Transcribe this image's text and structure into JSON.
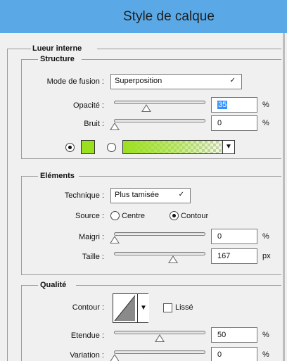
{
  "dialog": {
    "title": "Style de calque"
  },
  "lueur": {
    "heading": "Lueur interne",
    "structure": {
      "heading": "Structure",
      "mode_label": "Mode de fusion :",
      "mode_value": "Superposition",
      "opacity_label": "Opacité :",
      "opacity_value": "35",
      "opacity_unit": "%",
      "opacity_level": 0.35,
      "noise_label": "Bruit :",
      "noise_value": "0",
      "noise_unit": "%",
      "noise_level": 0,
      "color_swatch": "#9be01e",
      "color_mode": "color"
    },
    "elements": {
      "heading": "Eléments",
      "technique_label": "Technique :",
      "technique_value": "Plus tamisée",
      "source_label": "Source :",
      "source_center": "Centre",
      "source_edge": "Contour",
      "source_selected": "edge",
      "choke_label": "Maigri :",
      "choke_value": "0",
      "choke_unit": "%",
      "choke_level": 0,
      "size_label": "Taille :",
      "size_value": "167",
      "size_unit": "px"
    },
    "quality": {
      "heading": "Qualité",
      "contour_label": "Contour :",
      "antialias_label": "Lissé",
      "antialias_checked": false,
      "range_label": "Etendue :",
      "range_value": "50",
      "range_unit": "%",
      "range_level": 0.5,
      "jitter_label": "Variation :",
      "jitter_value": "0",
      "jitter_unit": "%",
      "jitter_level": 0
    }
  }
}
